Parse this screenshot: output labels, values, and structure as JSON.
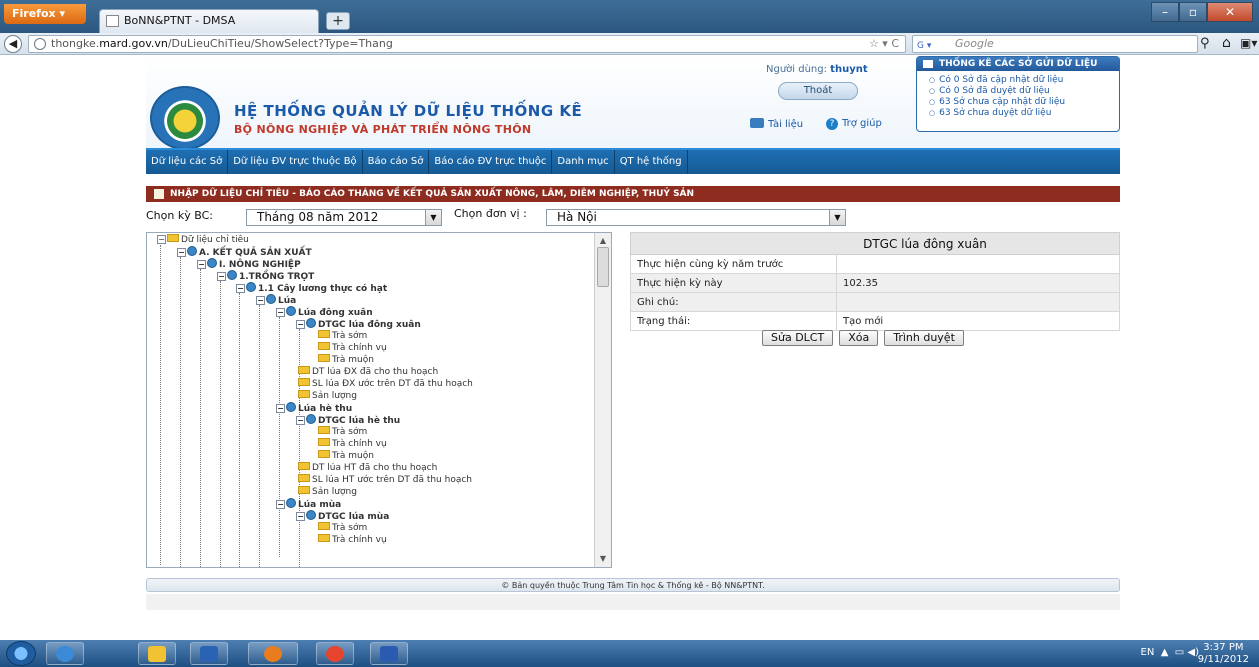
{
  "browser": {
    "menu_button": "Firefox",
    "tab_title": "BoNN&PTNT - DMSA",
    "url_prefix": "thongke.",
    "url_domain": "mard.gov.vn",
    "url_path": "/DuLieuChiTieu/ShowSelect?Type=Thang",
    "search_placeholder": "Google"
  },
  "header": {
    "title": "HỆ THỐNG QUẢN LÝ DỮ LIỆU THỐNG KÊ",
    "subtitle": "BỘ NÔNG NGHIỆP VÀ PHÁT TRIỂN NÔNG THÔN",
    "user_label": "Người dùng: ",
    "user_name": "thuynt",
    "logout": "Thoát",
    "docs": "Tài liệu",
    "help": "Trợ giúp"
  },
  "stats": {
    "title": "THỐNG KÊ CÁC SỞ GỬI DỮ LIỆU",
    "items": [
      "Có 0 Sở đã cập nhật dữ liệu",
      "Có 0 Sở đã duyệt dữ liệu",
      "63 Sở chưa cập nhật dữ liệu",
      "63 Sở chưa duyệt dữ liệu"
    ]
  },
  "menu": [
    "Dữ liệu các Sở",
    "Dữ liệu ĐV trực thuộc Bộ",
    "Báo cáo Sở",
    "Báo cáo ĐV trực thuộc",
    "Danh mục",
    "QT hệ thống"
  ],
  "section_title": "NHẬP DỮ LIỆU CHỈ TIÊU - BÁO CÁO THÁNG VỀ KẾT QUẢ SẢN XUẤT NÔNG, LÂM, DIÊM NGHIỆP, THUỶ SẢN",
  "filters": {
    "period_label": "Chọn kỳ BC:",
    "period_value": "Tháng 08 năm 2012",
    "unit_label": "Chọn đơn vị :",
    "unit_value": "Hà Nội"
  },
  "tree": [
    "Dữ liệu chỉ tiêu",
    "A. KẾT QUẢ SẢN XUẤT",
    "I. NÔNG NGHIỆP",
    "1.TRỒNG TRỌT",
    "1.1 Cây lương thực có hạt",
    "Lúa",
    "Lúa đông xuân",
    "DTGC lúa đông xuân",
    "Trà sớm",
    "Trà chính vụ",
    "Trà muộn",
    "DT lúa ĐX đã cho thu hoạch",
    "SL lúa ĐX ước trên DT đã thu hoạch",
    "Sản lượng",
    "Lúa hè thu",
    "DTGC lúa hè thu",
    "Trà sớm",
    "Trà chính vụ",
    "Trà muộn",
    "DT lúa HT đã cho thu hoạch",
    "SL lúa HT ước trên DT đã thu hoạch",
    "Sản lượng",
    "Lúa mùa",
    "DTGC lúa mùa",
    "Trà sớm",
    "Trà chính vụ"
  ],
  "detail": {
    "title": "DTGC lúa đông xuân",
    "rows": [
      {
        "label": "Thực hiện cùng kỳ năm trước",
        "value": ""
      },
      {
        "label": "Thực hiện kỳ này",
        "value": "102.35"
      },
      {
        "label": "Ghi chú:",
        "value": ""
      },
      {
        "label": "Trạng thái:",
        "value": "Tạo mới"
      }
    ],
    "buttons": [
      "Sửa DLCT",
      "Xóa",
      "Trình duyệt"
    ]
  },
  "footer": "© Bản quyền thuộc Trung Tâm Tin học & Thống kê - Bộ NN&PTNT.",
  "taskbar": {
    "lang": "EN",
    "time": "3:37 PM",
    "date": "9/11/2012"
  }
}
